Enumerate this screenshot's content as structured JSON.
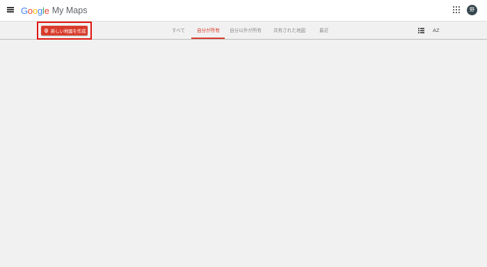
{
  "header": {
    "logo_letters": [
      {
        "char": "G",
        "color": "#4285f4"
      },
      {
        "char": "o",
        "color": "#ea4335"
      },
      {
        "char": "o",
        "color": "#fbbc05"
      },
      {
        "char": "g",
        "color": "#4285f4"
      },
      {
        "char": "l",
        "color": "#34a853"
      },
      {
        "char": "e",
        "color": "#ea4335"
      }
    ],
    "app_name": "My Maps",
    "menu_icon": "hamburger-menu-icon",
    "apps_icon": "apps-grid-icon",
    "avatar_initial": "野"
  },
  "toolbar": {
    "create_button_label": "新しい地図を作成",
    "create_button_icon": "add-map-icon",
    "tabs": [
      {
        "label": "すべて",
        "active": false
      },
      {
        "label": "自分が所有",
        "active": true
      },
      {
        "label": "自分以外が所有",
        "active": false
      },
      {
        "label": "共有された地図",
        "active": false
      },
      {
        "label": "最近",
        "active": false
      }
    ],
    "view_icon": "list-view-icon",
    "sort_icon": "sort-az-icon",
    "sort_label": "AZ"
  },
  "colors": {
    "accent": "#d93b2b",
    "highlight_border": "#e0140c",
    "background": "#f1f1f1"
  }
}
